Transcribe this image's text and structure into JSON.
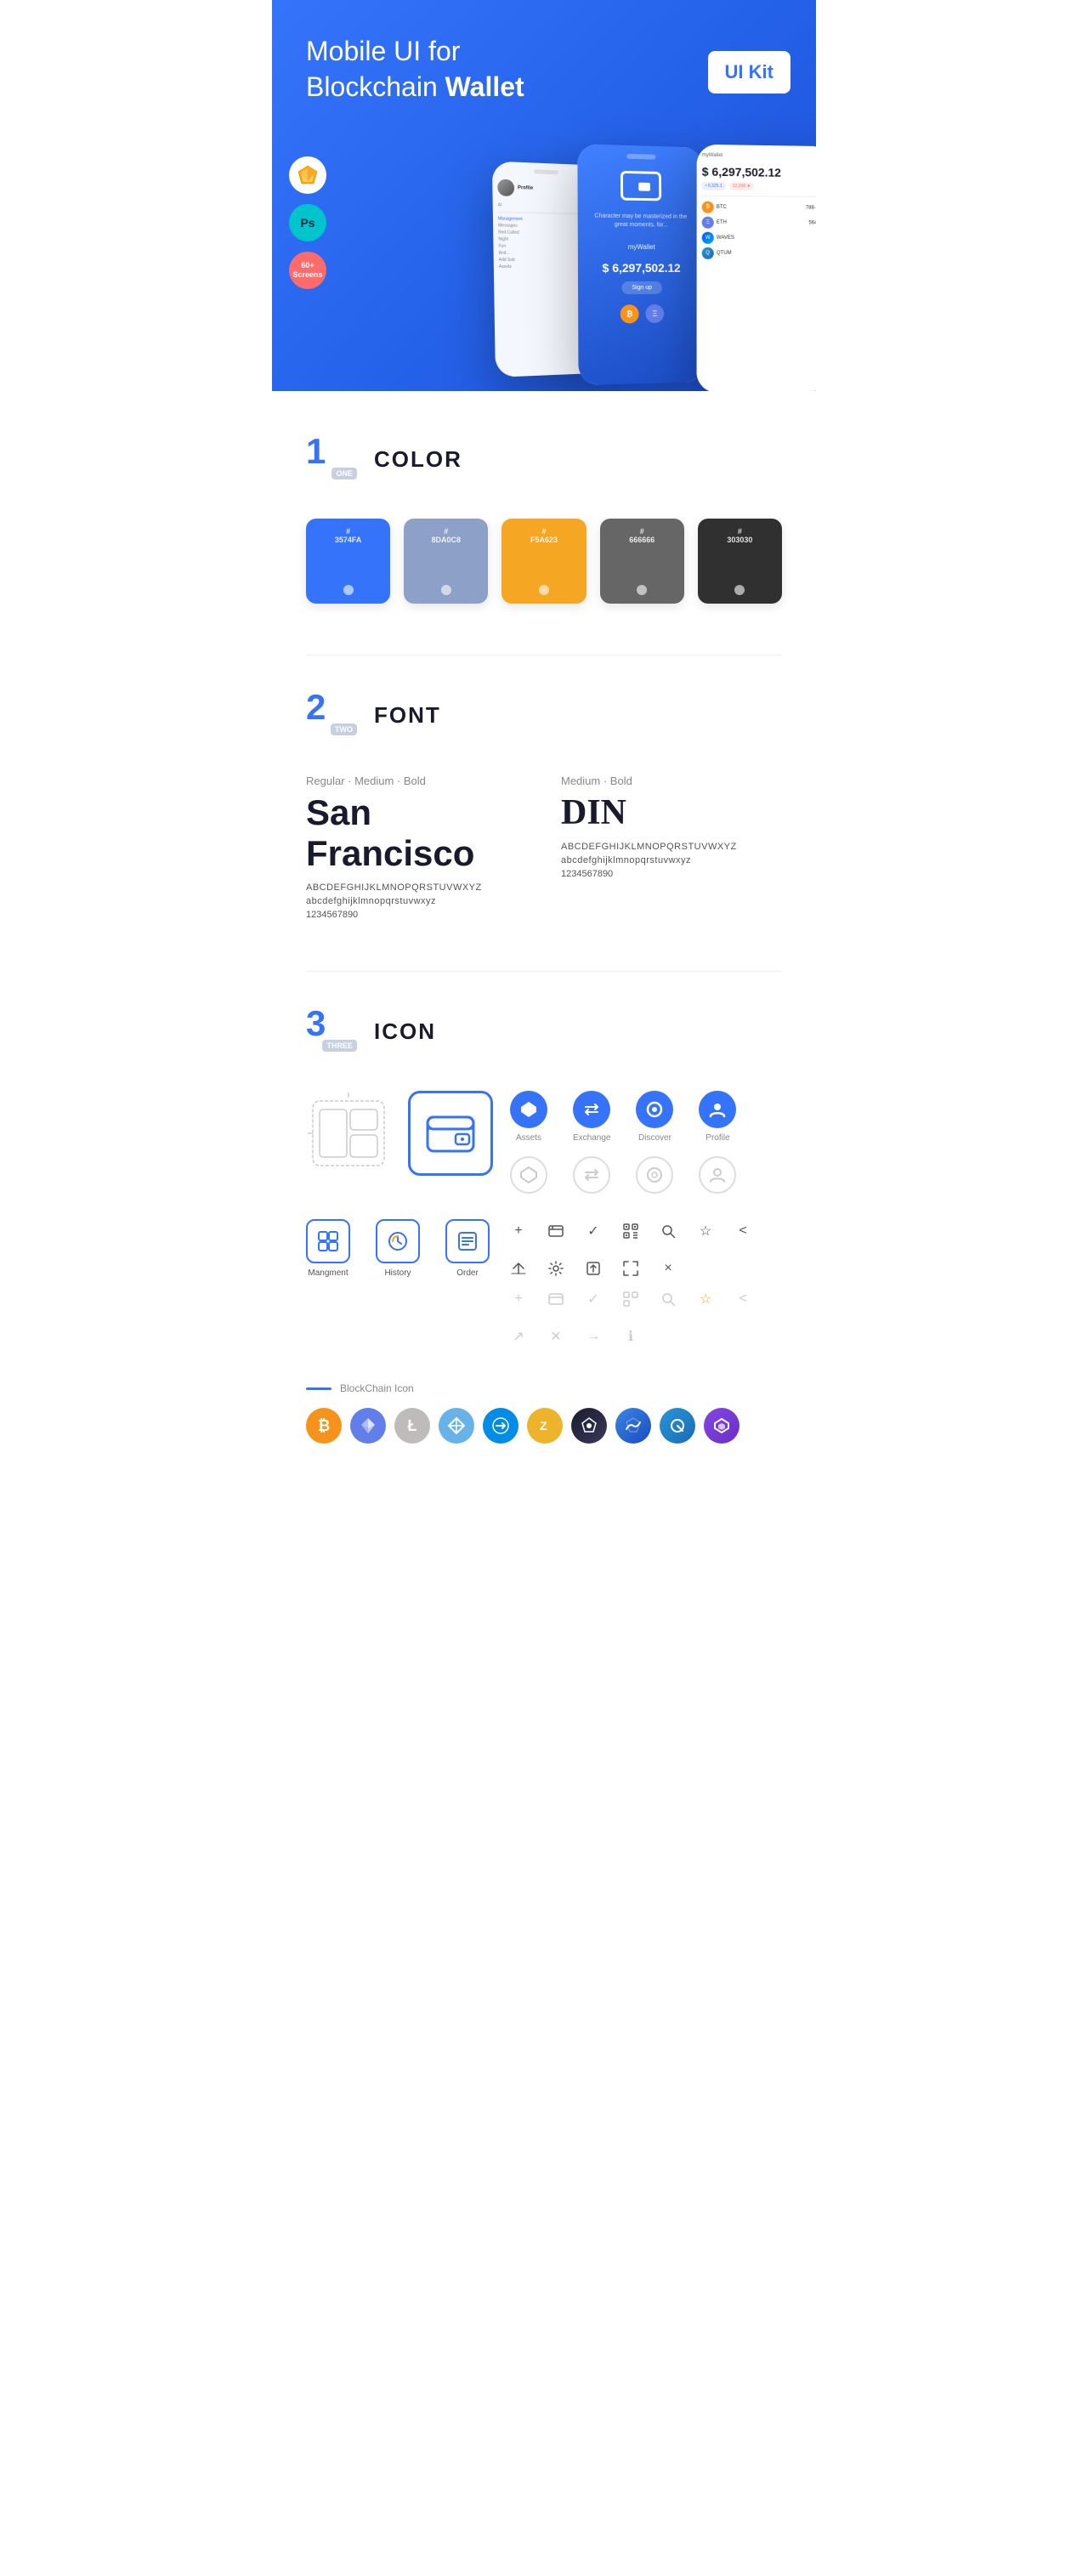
{
  "hero": {
    "title_plain": "Mobile UI for Blockchain ",
    "title_bold": "Wallet",
    "badge": "UI Kit",
    "tools": [
      {
        "name": "sketch-badge",
        "label": "Sketch"
      },
      {
        "name": "ps-badge",
        "label": "Ps"
      },
      {
        "name": "screens-badge",
        "label": "60+ Screens"
      }
    ]
  },
  "sections": {
    "color": {
      "number": "1",
      "word": "ONE",
      "title": "COLOR",
      "swatches": [
        {
          "hex": "#3574FA",
          "label": "#\n3574FA"
        },
        {
          "hex": "#8D A0C8",
          "label": "#\n8DA0C8"
        },
        {
          "hex": "#F5A623",
          "label": "#\nF5A623"
        },
        {
          "hex": "#666666",
          "label": "#\n666666"
        },
        {
          "hex": "#303030",
          "label": "#\n303030"
        }
      ]
    },
    "font": {
      "number": "2",
      "word": "TWO",
      "title": "FONT",
      "fonts": [
        {
          "weights": "Regular · Medium · Bold",
          "name": "San Francisco",
          "upper": "ABCDEFGHIJKLMNOPQRSTUVWXYZ",
          "lower": "abcdefghijklmnopqrstuvwxyz",
          "nums": "1234567890"
        },
        {
          "weights": "Medium · Bold",
          "name": "DIN",
          "upper": "ABCDEFGHIJKLMNOPQRSTUVWXYZ",
          "lower": "abcdefghijklmnopqrstuvwxyz",
          "nums": "1234567890"
        }
      ]
    },
    "icon": {
      "number": "3",
      "word": "THREE",
      "title": "ICON",
      "nav_icons": [
        {
          "label": "Assets",
          "symbol": "◆"
        },
        {
          "label": "Exchange",
          "symbol": "⇌"
        },
        {
          "label": "Discover",
          "symbol": "●"
        },
        {
          "label": "Profile",
          "symbol": "👤"
        }
      ],
      "app_icons": [
        {
          "label": "Mangment",
          "symbol": "▦"
        },
        {
          "label": "History",
          "symbol": "⏱"
        },
        {
          "label": "Order",
          "symbol": "≡"
        }
      ],
      "blockchain_label": "BlockChain Icon",
      "crypto_icons": [
        {
          "label": "BTC",
          "class": "crypto-btc",
          "symbol": "₿"
        },
        {
          "label": "ETH",
          "class": "crypto-eth",
          "symbol": "Ξ"
        },
        {
          "label": "LTC",
          "class": "crypto-ltc",
          "symbol": "Ł"
        },
        {
          "label": "NEM",
          "class": "crypto-nem",
          "symbol": "✦"
        },
        {
          "label": "DASH",
          "class": "crypto-dash",
          "symbol": "D"
        },
        {
          "label": "ZEC",
          "class": "crypto-zcash",
          "symbol": "Z"
        },
        {
          "label": "IOTA",
          "class": "crypto-iota",
          "symbol": "◈"
        },
        {
          "label": "WAVES",
          "class": "crypto-waves",
          "symbol": "W"
        },
        {
          "label": "QTUM",
          "class": "crypto-qtum",
          "symbol": "Q"
        },
        {
          "label": "MATIC",
          "class": "crypto-matic",
          "symbol": "M"
        }
      ]
    }
  }
}
